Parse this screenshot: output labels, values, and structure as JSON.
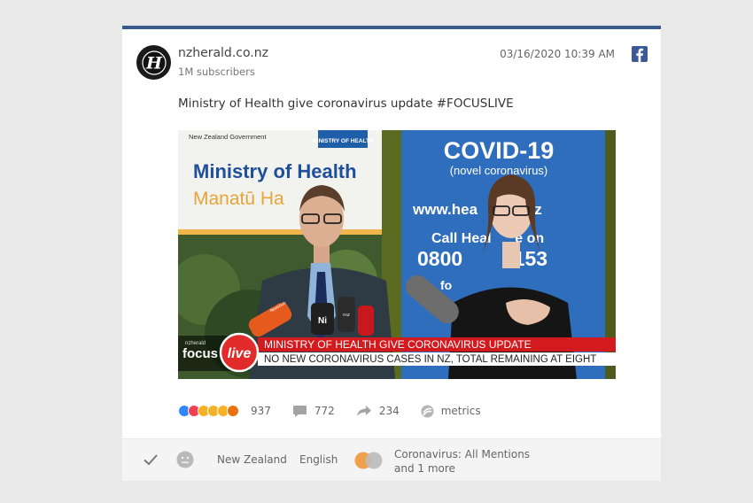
{
  "post": {
    "source_name": "nzherald.co.nz",
    "subscribers": "1M subscribers",
    "timestamp": "03/16/2020 10:39 AM",
    "text": "Ministry of Health give coronavirus update #FOCUSLIVE"
  },
  "media": {
    "nz_govt": "New Zealand Government",
    "ministry_logo": "MINISTRY OF HEALTH",
    "ministry_line1": "Ministry of Health",
    "ministry_line2": "Manatū Ha",
    "covid_title": "COVID-19",
    "covid_sub": "(novel coronavirus)",
    "covid_url": "www.hea     ovt.nz",
    "covid_call": "Call Heal      e on",
    "covid_number": "0800         153",
    "covid_fo": "fo",
    "nzherald_small": "nzherald",
    "focus": "focus",
    "live": "live",
    "headline": "MINISTRY OF HEALTH GIVE CORONAVIRUS UPDATE",
    "ticker": "NO NEW CORONAVIRUS CASES IN NZ, TOTAL REMAINING AT EIGHT",
    "mic_labels": [
      "ᴺᵉʷˢʰᵘᵇ",
      "Ni",
      "ʳⁿᶻ"
    ]
  },
  "stats": {
    "reactions": "937",
    "comments": "772",
    "shares": "234",
    "metrics": "metrics"
  },
  "footer": {
    "location": "New Zealand",
    "language": "English",
    "topic_line1": "Coronavirus: All Mentions",
    "topic_line2": "and 1 more"
  },
  "colors": {
    "accent_bar": "#3b5a8f",
    "facebook": "#3b5998",
    "toggle_on": "#f0a04b",
    "toggle_off": "#bdbdbd"
  },
  "icons": {
    "avatar": "nzherald-h-logo",
    "facebook": "facebook-icon",
    "comments": "comment-bubble-icon",
    "shares": "share-arrow-icon",
    "metrics": "metrics-icon",
    "check": "checkmark-icon",
    "sentiment": "neutral-face-icon"
  }
}
